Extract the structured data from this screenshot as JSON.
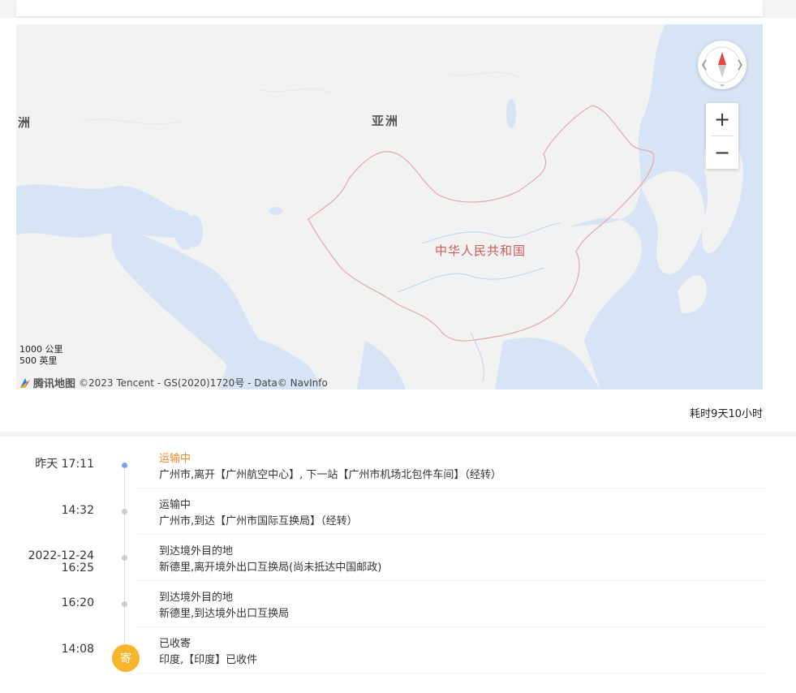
{
  "map": {
    "region_labels": [
      "洲",
      "亚洲"
    ],
    "country_label": "中华人民共和国",
    "scale_km": "1000 公里",
    "scale_mi": "500 英里",
    "logo_text": "腾讯地图",
    "copyright": "©2023 Tencent - GS(2020)1720号 - Data© NavInfo",
    "zoom_in": "+",
    "zoom_out": "−"
  },
  "duration": "耗时9天10小时",
  "events": [
    {
      "time": "昨天 17:11",
      "status": "运输中",
      "desc": "广州市,离开【广州航空中心】, 下一站【广州市机场北包件车间】（经转）",
      "active": true
    },
    {
      "time": "14:32",
      "status": "运输中",
      "desc": "广州市,到达【广州市国际互换局】（经转）",
      "active": false
    },
    {
      "time": "2022-12-24",
      "time2": "16:25",
      "status": "到达境外目的地",
      "desc": "新德里,离开境外出口互换局(尚未抵达中国邮政)",
      "active": false
    },
    {
      "time": "16:20",
      "status": "到达境外目的地",
      "desc": "新德里,到达境外出口互换局",
      "active": false
    },
    {
      "time": "14:08",
      "status": "已收寄",
      "desc": "印度,【印度】已收件",
      "active": false,
      "badge": "寄"
    }
  ],
  "colors": {
    "active_status": "#e8892a",
    "active_dot": "#7aa6ea",
    "badge": "#f7b52c",
    "border": "#d05a5a"
  },
  "icons": [
    "compass-icon",
    "zoom-in-icon",
    "zoom-out-icon",
    "tencent-map-logo-icon"
  ]
}
